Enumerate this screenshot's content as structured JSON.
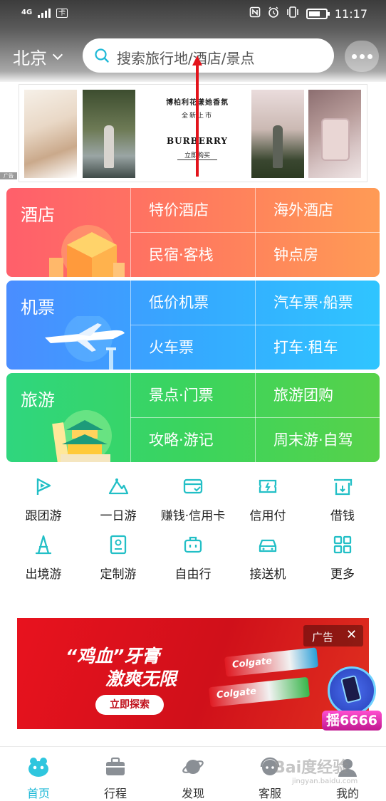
{
  "status_bar": {
    "network": "4G",
    "sim_label": "卡",
    "time": "11:17",
    "battery_level": 0.7,
    "icons": [
      "nfc-icon",
      "alarm-icon",
      "vibrate-icon",
      "battery-icon"
    ]
  },
  "header": {
    "city": "北京",
    "search_placeholder": "搜索旅行地/酒店/景点",
    "more_icon": "more-dots-icon",
    "annotation_arrow_color": "#e3141c"
  },
  "banner": {
    "headline": "博柏利花漾她香氛",
    "subline": "全新上市",
    "brand": "BURBERRY",
    "cta": "立即购买",
    "ad_mark": "广告"
  },
  "categories": [
    {
      "title": "酒店",
      "items": [
        "特价酒店",
        "海外酒店",
        "民宿·客栈",
        "钟点房"
      ],
      "color": "#ff6d62"
    },
    {
      "title": "机票",
      "items": [
        "低价机票",
        "汽车票·船票",
        "火车票",
        "打车·租车"
      ],
      "color": "#3fa6ff"
    },
    {
      "title": "旅游",
      "items": [
        "景点·门票",
        "旅游团购",
        "攻略·游记",
        "周末游·自驾"
      ],
      "color": "#3dd56a"
    }
  ],
  "quick_icons": [
    {
      "label": "跟团游",
      "icon": "flag-icon"
    },
    {
      "label": "一日游",
      "icon": "mountain-icon"
    },
    {
      "label": "赚钱·信用卡",
      "icon": "card-icon"
    },
    {
      "label": "信用付",
      "icon": "ticket-icon"
    },
    {
      "label": "借钱",
      "icon": "wallet-icon"
    },
    {
      "label": "出境游",
      "icon": "tower-icon"
    },
    {
      "label": "定制游",
      "icon": "book-icon"
    },
    {
      "label": "自由行",
      "icon": "luggage-icon"
    },
    {
      "label": "接送机",
      "icon": "car-icon"
    },
    {
      "label": "更多",
      "icon": "grid-icon"
    }
  ],
  "icon_color": "#22bfc6",
  "promo_ad": {
    "line1": "“鸡血”牙膏",
    "line2": "激爽无限",
    "button": "立即探索",
    "brand": "Colgate",
    "ad_label": "广告",
    "close": "✕"
  },
  "shake_badge": {
    "label": "揺6666"
  },
  "bottom_nav": [
    {
      "label": "首页",
      "icon": "home-icon",
      "active": true
    },
    {
      "label": "行程",
      "icon": "briefcase-icon",
      "active": false
    },
    {
      "label": "发现",
      "icon": "planet-icon",
      "active": false
    },
    {
      "label": "客服",
      "icon": "headset-icon",
      "active": false
    },
    {
      "label": "我的",
      "icon": "profile-icon",
      "active": false
    }
  ],
  "watermark": "Bai度经验",
  "watermark_sub": "jingyan.baidu.com"
}
